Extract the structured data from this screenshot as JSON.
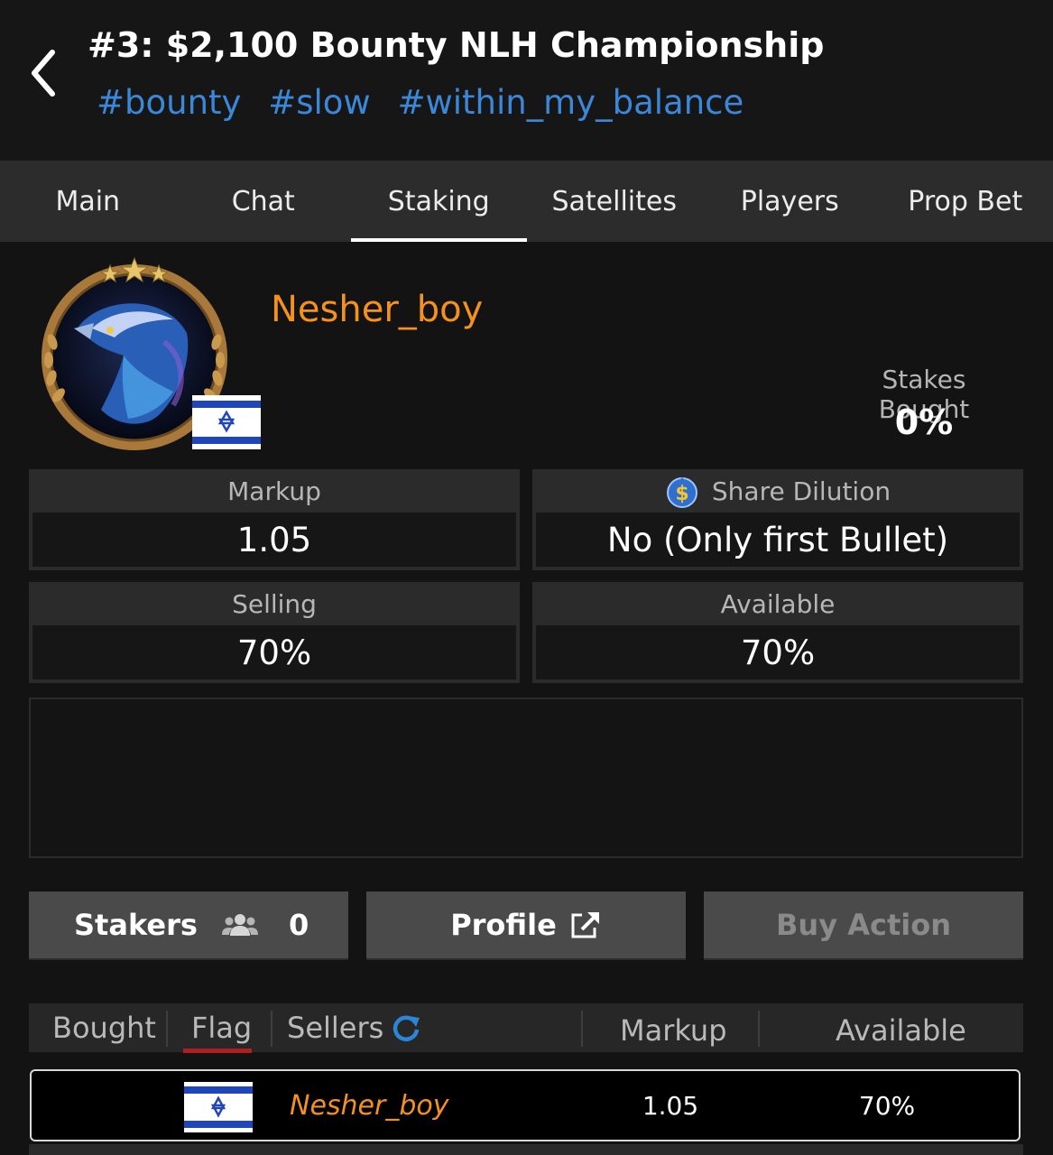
{
  "header": {
    "title": "#3: $2,100 Bounty NLH Championship",
    "tags": [
      "#bounty",
      "#slow",
      "#within_my_balance"
    ]
  },
  "tabs": [
    {
      "label": "Main",
      "active": false
    },
    {
      "label": "Chat",
      "active": false
    },
    {
      "label": "Staking",
      "active": true
    },
    {
      "label": "Satellites",
      "active": false
    },
    {
      "label": "Players",
      "active": false
    },
    {
      "label": "Prop Bet",
      "active": false
    }
  ],
  "player": {
    "name": "Nesher_boy",
    "country_flag": "israel-flag",
    "stakes_bought_label": "Stakes Bought",
    "stakes_bought_value": "0%"
  },
  "stats": {
    "markup_label": "Markup",
    "markup_value": "1.05",
    "dilution_label": "Share Dilution",
    "dilution_value": "No (Only first Bullet)",
    "selling_label": "Selling",
    "selling_value": "70%",
    "available_label": "Available",
    "available_value": "70%"
  },
  "actions": {
    "stakers_label": "Stakers",
    "stakers_count": "0",
    "profile_label": "Profile",
    "buy_label": "Buy Action"
  },
  "table": {
    "headers": {
      "bought": "Bought",
      "flag": "Flag",
      "sellers": "Sellers",
      "markup": "Markup",
      "available": "Available"
    },
    "rows": [
      {
        "flag": "israel-flag",
        "name": "Nesher_boy",
        "markup": "1.05",
        "available": "70%"
      }
    ]
  },
  "colors": {
    "background": "#131313",
    "accent_orange": "#f5921e",
    "tag_blue": "#3b87d8",
    "sort_underline": "#b11e1e"
  }
}
